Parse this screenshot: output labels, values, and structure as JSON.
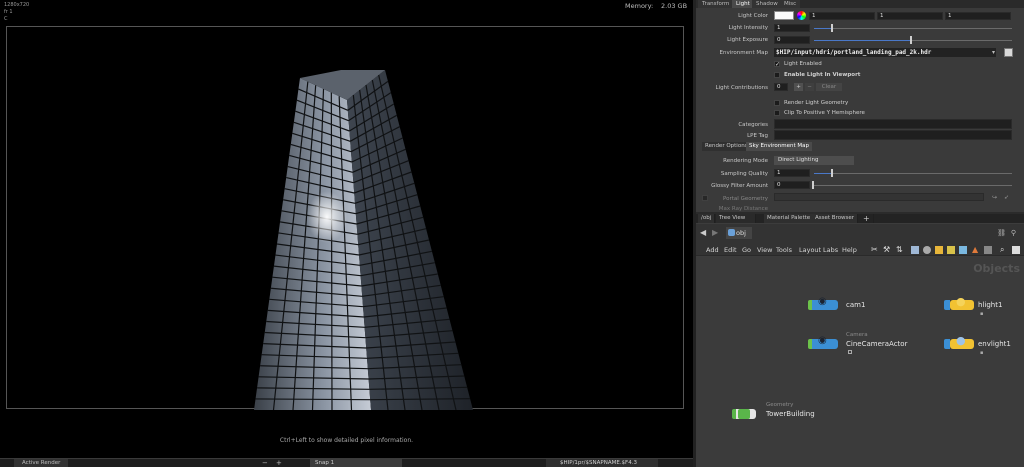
{
  "viewer": {
    "resolution": "1280x720",
    "line2": "fr 1",
    "line3": "C",
    "memory_label": "Memory:",
    "memory_value": "2.03 GB",
    "pixel_hint": "Ctrl+Left to show detailed pixel information."
  },
  "bottom_bar": {
    "tab": "Active Render",
    "minus": "−",
    "plus": "+",
    "snap": "Snap 1",
    "path": "$HIP/1pr/$SNAPNAME.$F4.3"
  },
  "params": {
    "tabs": [
      "Transform",
      "Light",
      "Shadow",
      "Misc"
    ],
    "active_tab": "Light",
    "light_color_label": "Light Color",
    "light_color_values": [
      "1",
      "1",
      "1"
    ],
    "light_intensity_label": "Light Intensity",
    "light_intensity_value": "1",
    "light_exposure_label": "Light Exposure",
    "light_exposure_value": "0",
    "env_map_label": "Environment Map",
    "env_map_value": "$HIP/input/hdri/portland_landing_pad_2k.hdr",
    "light_enabled_label": "Light Enabled",
    "enable_viewport_label": "Enable Light In Viewport",
    "light_contrib_label": "Light Contributions",
    "light_contrib_value": "0",
    "clear_label": "Clear",
    "render_geom_label": "Render Light Geometry",
    "clip_label": "Clip To Positive Y Hemisphere",
    "categories_label": "Categories",
    "lpe_label": "LPE Tag",
    "subtabs": [
      "Render Options",
      "Sky Environment Map"
    ],
    "rendering_mode_label": "Rendering Mode",
    "rendering_mode_value": "Direct Lighting",
    "sampling_label": "Sampling Quality",
    "sampling_value": "1",
    "glossy_label": "Glossy Filter Amount",
    "glossy_value": "0",
    "portal_label": "Portal Geometry",
    "max_ray_label": "Max Ray Distance"
  },
  "network": {
    "tabs": [
      "/obj",
      "Tree View",
      "Material Palette",
      "Asset Browser"
    ],
    "add_tab": "+",
    "path": "obj",
    "menu": [
      "Add",
      "Edit",
      "Go",
      "View",
      "Tools",
      "Layout",
      "Labs",
      "Help"
    ],
    "context_title": "Objects",
    "nodes": {
      "cam1": {
        "label": "cam1",
        "sublabel": ""
      },
      "cine": {
        "label": "CineCameraActor",
        "sublabel": "Camera"
      },
      "hlight": {
        "label": "hlight1",
        "sublabel": ""
      },
      "envlight": {
        "label": "envlight1",
        "sublabel": ""
      },
      "tower": {
        "label": "TowerBuilding",
        "sublabel": "Geometry"
      }
    }
  },
  "colors": {
    "accent": "#4a78c8",
    "node_blue": "#3b8fd4",
    "node_yellow": "#f2c232",
    "node_green": "#5ab54a",
    "viewer_bg": "#000000"
  }
}
